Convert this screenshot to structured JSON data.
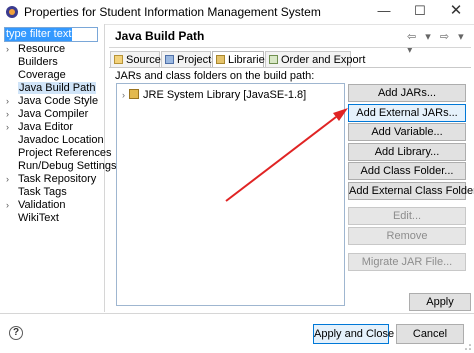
{
  "window": {
    "title": "Properties for Student Information Management System",
    "minimize": "—",
    "maximize": "☐",
    "close": "✕"
  },
  "filter": {
    "value": "type filter text"
  },
  "tree": {
    "items": [
      {
        "label": "Resource",
        "expand": "›"
      },
      {
        "label": "Builders",
        "expand": ""
      },
      {
        "label": "Coverage",
        "expand": ""
      },
      {
        "label": "Java Build Path",
        "expand": "",
        "selected": true
      },
      {
        "label": "Java Code Style",
        "expand": "›"
      },
      {
        "label": "Java Compiler",
        "expand": "›"
      },
      {
        "label": "Java Editor",
        "expand": "›"
      },
      {
        "label": "Javadoc Location",
        "expand": ""
      },
      {
        "label": "Project References",
        "expand": ""
      },
      {
        "label": "Run/Debug Settings",
        "expand": ""
      },
      {
        "label": "Task Repository",
        "expand": "›"
      },
      {
        "label": "Task Tags",
        "expand": ""
      },
      {
        "label": "Validation",
        "expand": "›"
      },
      {
        "label": "WikiText",
        "expand": ""
      }
    ]
  },
  "page": {
    "title": "Java Build Path",
    "nav": "⇦ ▾ ⇨ ▾ ▾"
  },
  "tabs": [
    {
      "label": "Source",
      "icon": "source-folder-icon"
    },
    {
      "label": "Projects",
      "icon": "projects-icon"
    },
    {
      "label": "Libraries",
      "icon": "libraries-icon",
      "active": true
    },
    {
      "label": "Order and Export",
      "icon": "order-export-icon"
    }
  ],
  "libraries": {
    "label": "JARs and class folders on the build path:",
    "entries": [
      {
        "label": "JRE System Library [JavaSE-1.8]",
        "expand": "›",
        "icon": "library-jar-icon"
      }
    ]
  },
  "buttons": {
    "add_jars": "Add JARs...",
    "add_external_jars": "Add External JARs...",
    "add_variable": "Add Variable...",
    "add_library": "Add Library...",
    "add_class_folder": "Add Class Folder...",
    "add_external_class_folder": "Add External Class Folder...",
    "edit": "Edit...",
    "remove": "Remove",
    "migrate_jar": "Migrate JAR File...",
    "apply": "Apply",
    "apply_and_close": "Apply and Close",
    "cancel": "Cancel",
    "help": "?"
  },
  "colors": {
    "annotation_arrow": "#e02424",
    "selection": "#3399ff",
    "focus_border": "#0078d7"
  }
}
